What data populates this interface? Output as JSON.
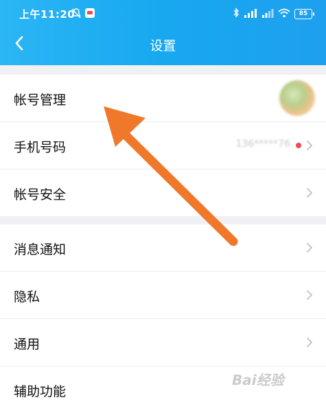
{
  "statusbar": {
    "time": "上午11:20",
    "battery": "85"
  },
  "header": {
    "title": "设置"
  },
  "groups": [
    {
      "items": [
        {
          "label": "帐号管理"
        },
        {
          "label": "手机号码",
          "value": "136*****76"
        },
        {
          "label": "帐号安全"
        }
      ]
    },
    {
      "items": [
        {
          "label": "消息通知"
        },
        {
          "label": "隐私"
        },
        {
          "label": "通用"
        },
        {
          "label": "辅助功能"
        }
      ]
    }
  ],
  "watermark": "Bai经验",
  "colors": {
    "header": "#1ea8f0",
    "arrow": "#f0782a",
    "dot": "#f24b53"
  }
}
